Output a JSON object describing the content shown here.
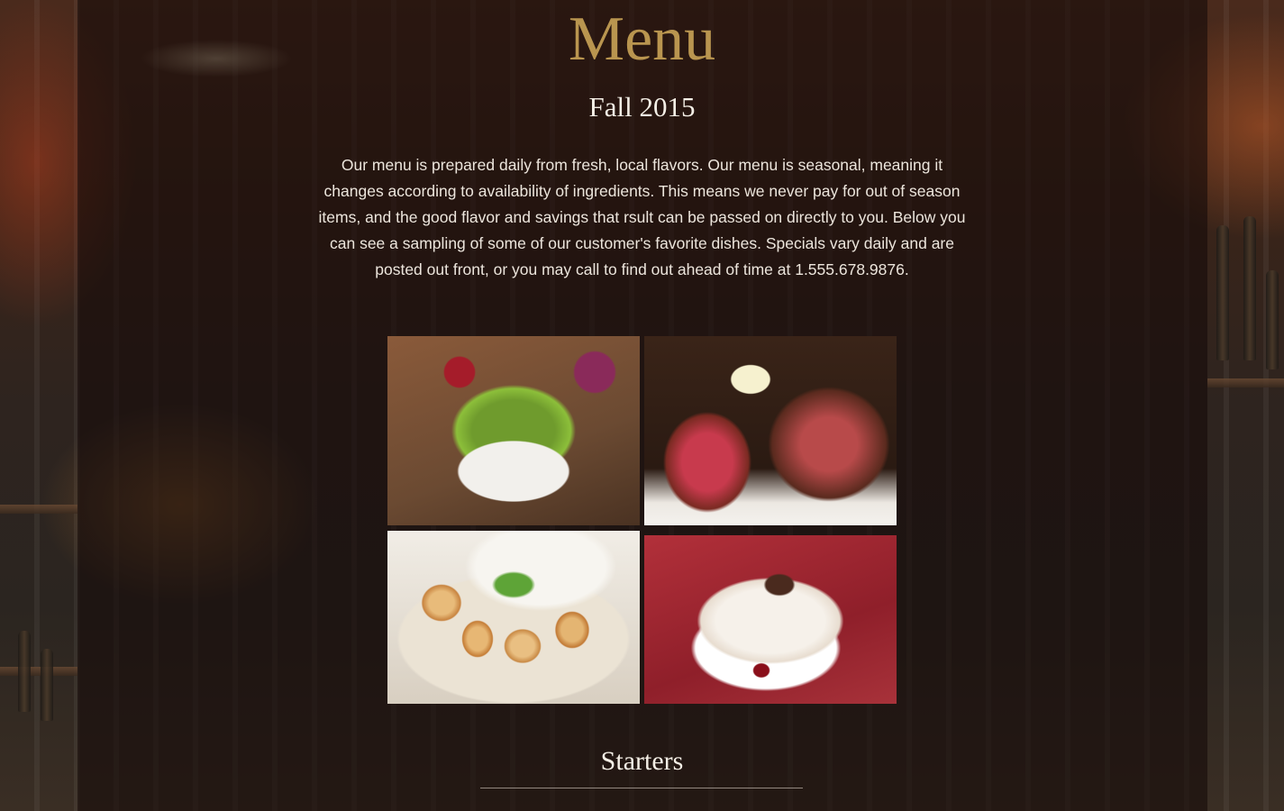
{
  "page": {
    "title": "Menu",
    "season": "Fall 2015",
    "intro": "Our menu is prepared daily from fresh, local flavors. Our menu is seasonal, meaning it changes according to availability of ingredients. This means we never pay for out of season items, and the good flavor and savings that rsult can be passed on directly to you. Below you can see a sampling of some of our customer's favorite dishes. Specials vary daily and are posted out front, or you may call to find out ahead of time at 1.555.678.9876."
  },
  "gallery": [
    {
      "alt": "salad"
    },
    {
      "alt": "steak"
    },
    {
      "alt": "scallops"
    },
    {
      "alt": "dessert"
    }
  ],
  "sections": {
    "starters": "Starters"
  },
  "colors": {
    "title_gold": "#b9954f",
    "text_light": "#ece5dc",
    "panel_overlay": "rgba(22, 12, 10, 0.62)"
  }
}
